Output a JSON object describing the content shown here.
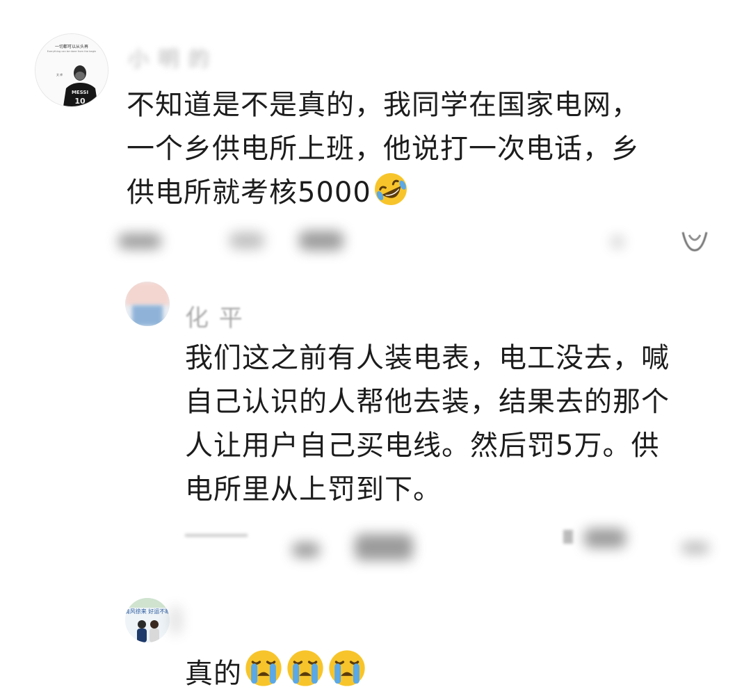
{
  "comments": [
    {
      "username": "小 明 的",
      "text": "不知道是不是真的，我同学在国家电网，\n一个乡供电所上班，他说打一次电话，乡\n供电所就考核5000",
      "emoji": "rofl-face-icon",
      "avatar": {
        "caption_top": "一切都可以从头再",
        "caption_sub": "Everything can be done from the begin",
        "jersey": "MESSI"
      }
    },
    {
      "username": "化 平",
      "text": "我们这之前有人装电表，电工没去，喊\n自己认识的人帮他去装，结果去的那个\n人让用户自己买电线。然后罚5万。供\n电所里从上罚到下。"
    },
    {
      "text": "真的",
      "emoji": "loudly-crying-face-icon",
      "avatar": {
        "caption": "清风徐来 好运不断"
      }
    }
  ],
  "colors": {
    "text": "#1c1c1c",
    "meta": "#b3b3b3",
    "emoji_yellow": "#f7c52b",
    "tear_blue": "#5aa8e6"
  }
}
